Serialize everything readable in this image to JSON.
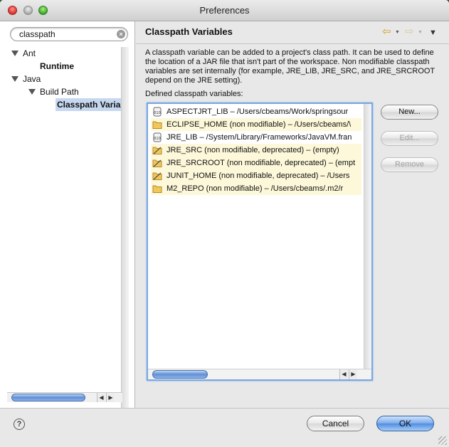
{
  "window": {
    "title": "Preferences"
  },
  "filter": {
    "value": "classpath"
  },
  "tree": [
    {
      "label": "Ant",
      "bold": false,
      "expanded": true
    },
    {
      "label": "Runtime",
      "bold": true
    },
    {
      "label": "Java",
      "bold": false,
      "expanded": true
    },
    {
      "label": "Build Path",
      "bold": false,
      "expanded": true
    },
    {
      "label": "Classpath Varial",
      "bold": true,
      "selected": true
    }
  ],
  "page": {
    "title": "Classpath Variables",
    "description": "A classpath variable can be added to a project's class path. It can be used to define the location of a JAR file that isn't part of the workspace. Non modifiable classpath variables are set internally (for example, JRE_LIB, JRE_SRC, and JRE_SRCROOT depend on the JRE setting).",
    "list_label": "Defined classpath variables:",
    "variables": [
      {
        "text": "ASPECTJRT_LIB – /Users/cbeams/Work/springsour",
        "icon": "jar-icon",
        "shaded": false
      },
      {
        "text": "ECLIPSE_HOME (non modifiable) – /Users/cbeams/\\",
        "icon": "folder-icon",
        "shaded": true
      },
      {
        "text": "JRE_LIB – /System/Library/Frameworks/JavaVM.fran",
        "icon": "jar-icon",
        "shaded": false
      },
      {
        "text": "JRE_SRC (non modifiable, deprecated) – (empty)",
        "icon": "folder-deprecated-icon",
        "shaded": true
      },
      {
        "text": "JRE_SRCROOT (non modifiable, deprecated) – (empt",
        "icon": "folder-deprecated-icon",
        "shaded": true
      },
      {
        "text": "JUNIT_HOME (non modifiable, deprecated) – /Users",
        "icon": "folder-deprecated-icon",
        "shaded": true
      },
      {
        "text": "M2_REPO (non modifiable) – /Users/cbeams/.m2/r",
        "icon": "folder-icon",
        "shaded": true
      }
    ],
    "buttons": {
      "new": "New...",
      "edit": "Edit...",
      "remove": "Remove"
    }
  },
  "footer": {
    "cancel": "Cancel",
    "ok": "OK",
    "help": "?"
  },
  "colors": {
    "selection": "#c6d8f0",
    "list_focus": "#7aa7e3",
    "shaded_row": "#fdf8d9"
  }
}
